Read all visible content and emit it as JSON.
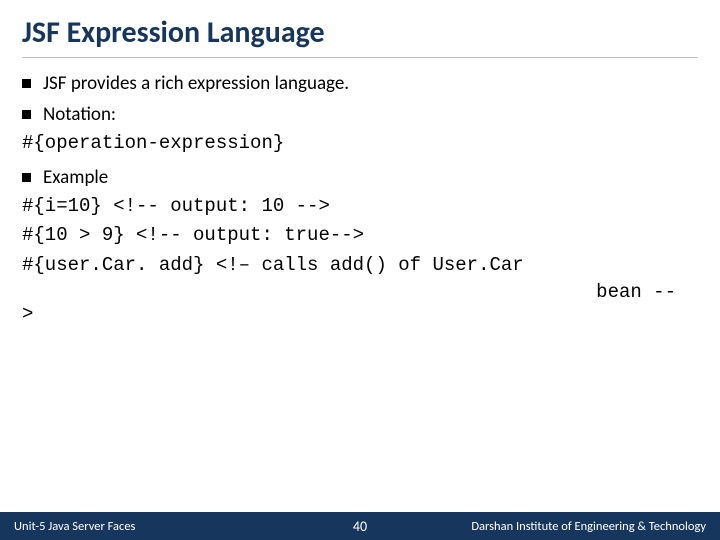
{
  "title": "JSF Expression Language",
  "bullets": {
    "b1": "JSF provides a rich expression language.",
    "b2": "Notation:",
    "b3": "Example"
  },
  "code": {
    "notation": "#{operation-expression}",
    "ex1": "#{i=10} <!-- output: 10 -->",
    "ex2": "#{10 > 9} <!-- output: true-->",
    "ex3": "#{user.Car. add} <!– calls add() of User.Car",
    "ex3b": "bean     --",
    "gt": ">"
  },
  "footer": {
    "left": "Unit-5 Java Server Faces",
    "page": "40",
    "right": "Darshan Institute of Engineering & Technology"
  }
}
